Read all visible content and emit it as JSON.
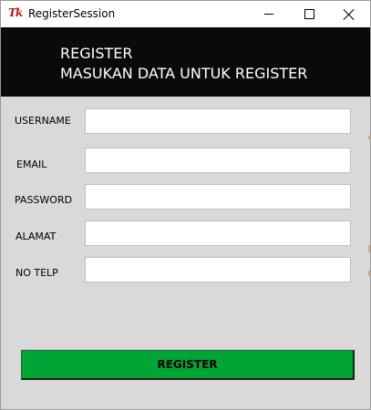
{
  "window": {
    "icon_text": "Tk",
    "title": "RegisterSession"
  },
  "header": {
    "line1": "REGISTER",
    "line2": "MASUKAN DATA UNTUK REGISTER"
  },
  "form": {
    "fields": [
      {
        "label": "USERNAME",
        "value": "",
        "placeholder": ""
      },
      {
        "label": "EMAIL",
        "value": "",
        "placeholder": ""
      },
      {
        "label": "PASSWORD",
        "value": "",
        "placeholder": ""
      },
      {
        "label": "ALAMAT",
        "value": "",
        "placeholder": ""
      },
      {
        "label": "NO TELP",
        "value": "",
        "placeholder": ""
      }
    ],
    "submit_label": "REGISTER"
  },
  "colors": {
    "header_bg": "#0a0a0a",
    "window_bg": "#d9d9d9",
    "button_bg": "#00a536"
  }
}
